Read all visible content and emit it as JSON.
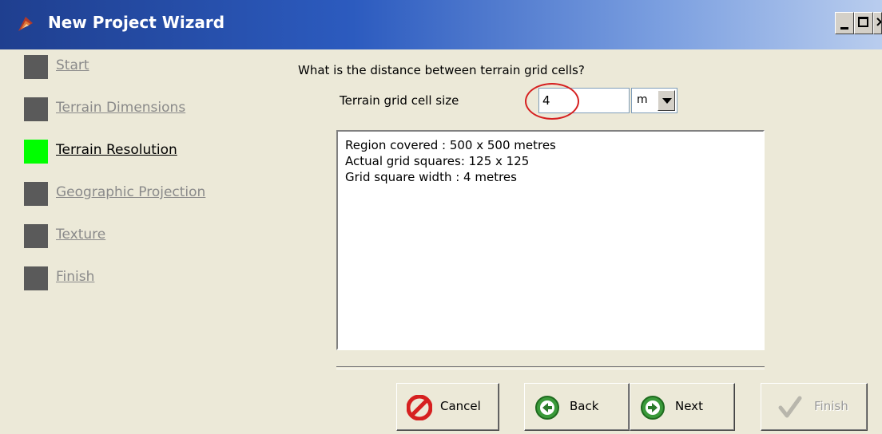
{
  "window": {
    "title": "New Project Wizard"
  },
  "nav": {
    "items": [
      {
        "label": "Start",
        "active": false
      },
      {
        "label": "Terrain Dimensions",
        "active": false
      },
      {
        "label": "Terrain Resolution",
        "active": true
      },
      {
        "label": "Geographic Projection",
        "active": false
      },
      {
        "label": "Texture",
        "active": false
      },
      {
        "label": "Finish",
        "active": false
      }
    ]
  },
  "main": {
    "question": "What is the distance between terrain grid cells?",
    "cell_size_label": "Terrain grid cell size",
    "cell_size_value": "4",
    "unit_value": "m",
    "info_lines": [
      "Region covered : 500 x 500 metres",
      "Actual grid squares: 125 x 125",
      "Grid square width : 4 metres"
    ]
  },
  "buttons": {
    "cancel": "Cancel",
    "back": "Back",
    "next": "Next",
    "finish": "Finish"
  },
  "colors": {
    "active_step": "#00ff00",
    "inactive_step": "#5a5a5a",
    "titlebar": "#2c5bbf",
    "highlight_ring": "#d62020"
  },
  "icons": {
    "title": "wizard-app-icon",
    "cancel": "stop-icon",
    "back": "back-arrow-icon",
    "next": "next-arrow-icon",
    "finish": "checkmark-icon"
  }
}
